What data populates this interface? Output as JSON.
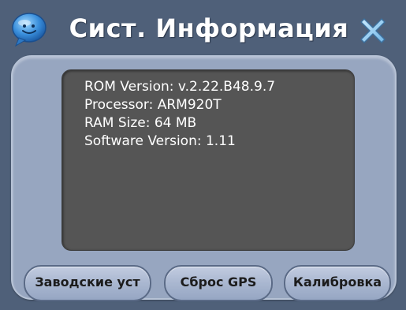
{
  "window": {
    "title": "Сист. Информация",
    "app_icon": "chat-bubble-icon",
    "close_icon": "close-icon"
  },
  "info": {
    "rom_version": "ROM Version: v.2.22.B48.9.7",
    "processor": "Processor: ARM920T",
    "ram_size": "RAM Size: 64 MB",
    "software_version": "Software Version: 1.11"
  },
  "buttons": {
    "factory_settings": "Заводские уст",
    "reset_gps": "Сброс GPS",
    "calibration": "Калибровка"
  },
  "colors": {
    "background": "#4f6079",
    "panel": "#97a6c0",
    "info_box": "#555555",
    "accent": "#3a8fdc"
  }
}
